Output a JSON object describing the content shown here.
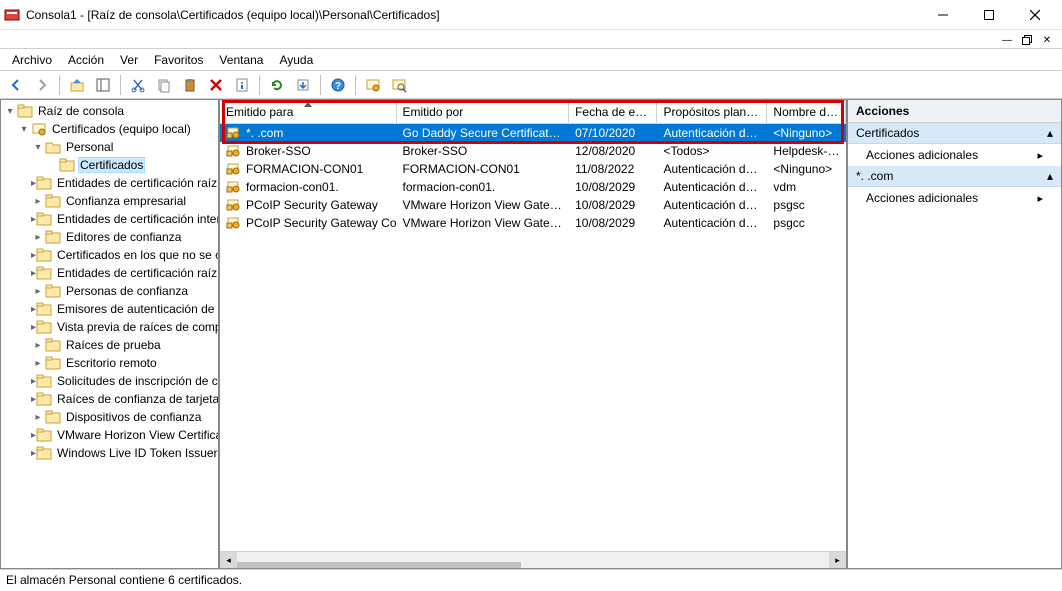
{
  "window": {
    "title": "Consola1 - [Raíz de consola\\Certificados (equipo local)\\Personal\\Certificados]",
    "min_tooltip": "Minimizar",
    "max_tooltip": "Maximizar",
    "close_tooltip": "Cerrar"
  },
  "menu": {
    "archivo": "Archivo",
    "accion": "Acción",
    "ver": "Ver",
    "favoritos": "Favoritos",
    "ventana": "Ventana",
    "ayuda": "Ayuda"
  },
  "tree": {
    "root": "Raíz de consola",
    "certs_local": "Certificados (equipo local)",
    "personal": "Personal",
    "certificados": "Certificados",
    "items": [
      "Entidades de certificación raíz de c",
      "Confianza empresarial",
      "Entidades de certificación intermed",
      "Editores de confianza",
      "Certificados en los que no se confí",
      "Entidades de certificación raíz de te",
      "Personas de confianza",
      "Emisores de autenticación de clien",
      "Vista previa de raíces de compilaci",
      "Raíces de prueba",
      "Escritorio remoto",
      "Solicitudes de inscripción de certifi",
      "Raíces de confianza de tarjetas inte",
      "Dispositivos de confianza",
      "VMware Horizon View Certificates",
      "Windows Live ID Token Issuer"
    ]
  },
  "list": {
    "columns": {
      "issued_to": "Emitido para",
      "issued_by": "Emitido por",
      "expiry": "Fecha de expir...",
      "purposes": "Propósitos plantea...",
      "friendly": "Nombre desc"
    },
    "rows": [
      {
        "to": "*.        .com",
        "by": "Go Daddy Secure Certificate Auth...",
        "exp": "07/10/2020",
        "purp": "Autenticación del s...",
        "name": "<Ninguno>",
        "selected": true
      },
      {
        "to": "Broker-SSO",
        "by": "Broker-SSO",
        "exp": "12/08/2020",
        "purp": "<Todos>",
        "name": "Helpdesk-key"
      },
      {
        "to": "FORMACION-CON01",
        "by": "FORMACION-CON01",
        "exp": "11/08/2022",
        "purp": "Autenticación del s...",
        "name": "<Ninguno>"
      },
      {
        "to": "formacion-con01.",
        "by": "formacion-con01.",
        "exp": "10/08/2029",
        "purp": "Autenticación del s...",
        "name": "vdm"
      },
      {
        "to": "PCoIP Security Gateway",
        "by": "VMware Horizon View Gateway R...",
        "exp": "10/08/2029",
        "purp": "Autenticación del s...",
        "name": "psgsc"
      },
      {
        "to": "PCoIP Security Gateway Contro...",
        "by": "VMware Horizon View Gateway R...",
        "exp": "10/08/2029",
        "purp": "Autenticación del c...",
        "name": "psgcc"
      }
    ]
  },
  "actions": {
    "header": "Acciones",
    "group1": "Certificados",
    "item1": "Acciones adicionales",
    "group2": "*.        .com",
    "item2": "Acciones adicionales"
  },
  "status": {
    "text": "El almacén Personal contiene 6 certificados."
  }
}
